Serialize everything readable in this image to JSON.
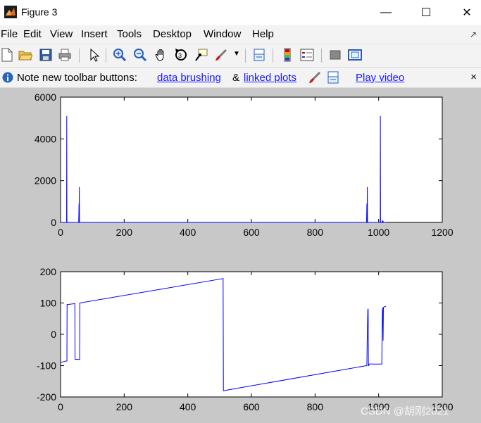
{
  "window": {
    "title": "Figure 3",
    "controls": {
      "minimize": "—",
      "maximize": "☐",
      "close": "✕"
    }
  },
  "menubar": {
    "items": [
      {
        "label": "File"
      },
      {
        "label": "Edit"
      },
      {
        "label": "View"
      },
      {
        "label": "Insert"
      },
      {
        "label": "Tools"
      },
      {
        "label": "Desktop"
      },
      {
        "label": "Window"
      },
      {
        "label": "Help"
      }
    ]
  },
  "toolbar": {
    "icons": [
      "new-figure-icon",
      "open-file-icon",
      "save-icon",
      "print-icon",
      "edit-plot-arrow-icon",
      "zoom-in-icon",
      "zoom-out-icon",
      "pan-hand-icon",
      "rotate-3d-icon",
      "data-cursor-icon",
      "brush-icon",
      "brush-dropdown-icon",
      "link-plot-icon",
      "colorbar-icon",
      "legend-icon",
      "hide-plot-tools-icon",
      "show-plot-tools-icon"
    ]
  },
  "infobar": {
    "note": "Note new toolbar buttons:",
    "link_brushing": "data brushing",
    "amp": "&",
    "link_linked": "linked plots",
    "link_video": "Play video",
    "close": "×"
  },
  "colors": {
    "series": "#0000ff",
    "background": "#c8c8c8",
    "axes_bg": "#ffffff"
  },
  "watermark": "CSDN @胡刚2021",
  "chart_data": [
    {
      "type": "line",
      "title": "",
      "xlabel": "",
      "ylabel": "",
      "xlim": [
        0,
        1200
      ],
      "ylim": [
        0,
        6000
      ],
      "xticks": [
        0,
        200,
        400,
        600,
        800,
        1000,
        1200
      ],
      "yticks": [
        0,
        2000,
        4000,
        6000
      ],
      "grid": false,
      "series": [
        {
          "x": [
            0,
            18,
            19,
            19.5,
            20,
            21,
            57,
            58,
            58.5,
            59,
            59.5,
            60,
            61,
            962,
            963,
            964,
            964.5,
            965,
            966,
            1004,
            1005,
            1005.5,
            1006,
            1007,
            1010,
            1012,
            1013,
            1014,
            1015,
            1023
          ],
          "y": [
            0,
            0,
            0,
            5100,
            0,
            0,
            0,
            900,
            0,
            1700,
            0,
            0,
            0,
            0,
            900,
            0,
            1700,
            0,
            0,
            0,
            0,
            5100,
            0,
            0,
            0,
            80,
            0,
            60,
            0,
            0
          ]
        }
      ]
    },
    {
      "type": "line",
      "title": "",
      "xlabel": "",
      "ylabel": "",
      "xlim": [
        0,
        1200
      ],
      "ylim": [
        -200,
        200
      ],
      "xticks": [
        0,
        200,
        400,
        600,
        800,
        1000,
        1200
      ],
      "yticks": [
        -200,
        -100,
        0,
        100,
        200
      ],
      "grid": false,
      "series": [
        {
          "x": [
            0,
            18,
            20,
            20.5,
            45,
            45.5,
            58,
            60,
            60.5,
            511,
            512,
            962,
            963,
            964,
            965,
            966,
            967,
            968,
            969,
            970,
            1000,
            1010,
            1011,
            1012,
            1013,
            1014,
            1015,
            1023
          ],
          "y": [
            -90,
            -85,
            -85,
            95,
            98,
            -80,
            -80,
            -80,
            100,
            178,
            -180,
            -100,
            -100,
            -20,
            30,
            80,
            80,
            -100,
            -100,
            -95,
            -95,
            -95,
            20,
            85,
            70,
            -20,
            86,
            90
          ]
        }
      ]
    }
  ]
}
